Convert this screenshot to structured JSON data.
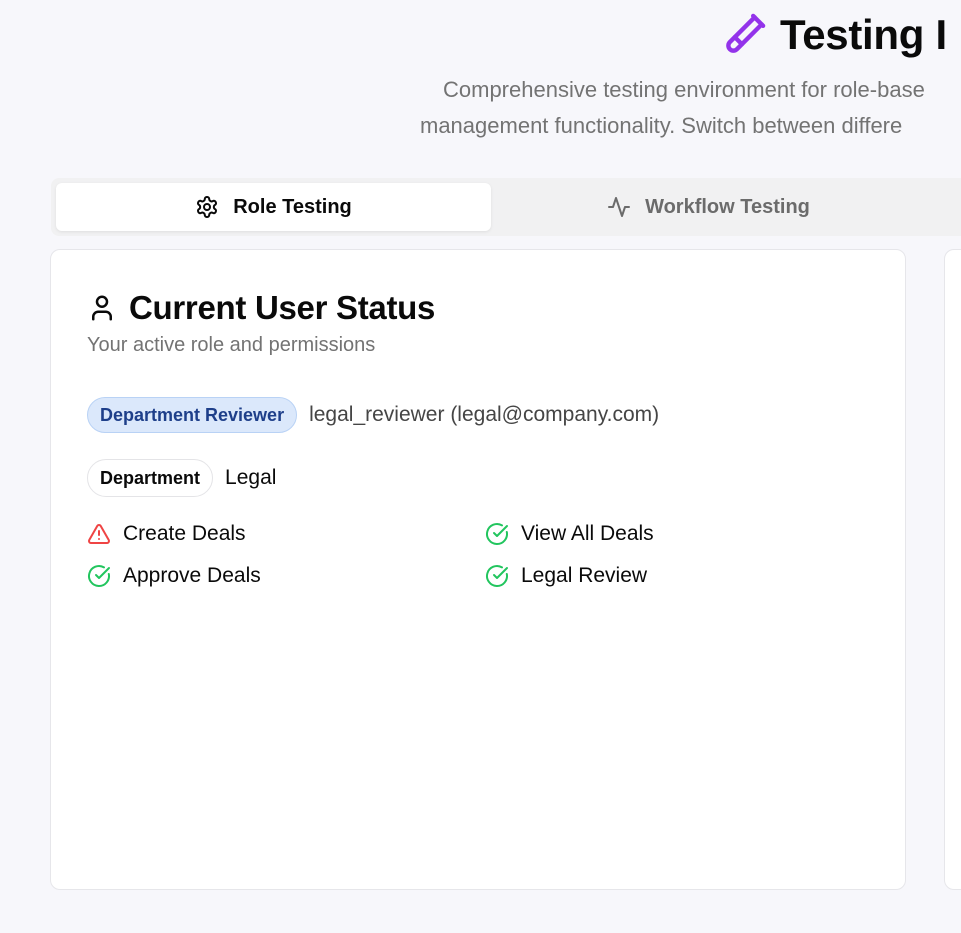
{
  "header": {
    "title": "Testing I",
    "subtitle_line1": "Comprehensive testing environment for role-base",
    "subtitle_line2": "management functionality. Switch between differe"
  },
  "tabs": [
    {
      "label": "Role Testing",
      "icon": "settings-gear-icon",
      "active": true
    },
    {
      "label": "Workflow Testing",
      "icon": "activity-pulse-icon",
      "active": false
    }
  ],
  "user_status": {
    "title": "Current User Status",
    "description": "Your active role and permissions",
    "role_badge": "Department Reviewer",
    "user": "legal_reviewer (legal@company.com)",
    "department_badge": "Department",
    "department": "Legal",
    "permissions": [
      {
        "label": "Create Deals",
        "granted": false,
        "icon": "alert-triangle-icon"
      },
      {
        "label": "View All Deals",
        "granted": true,
        "icon": "check-circle-icon"
      },
      {
        "label": "Approve Deals",
        "granted": true,
        "icon": "check-circle-icon"
      },
      {
        "label": "Legal Review",
        "granted": true,
        "icon": "check-circle-icon"
      }
    ]
  },
  "colors": {
    "accent_purple": "#9333ea",
    "granted_green": "#22c55e",
    "denied_red": "#ef4444",
    "role_badge_bg": "#dbe8fb",
    "role_badge_text": "#1e3f8a"
  }
}
